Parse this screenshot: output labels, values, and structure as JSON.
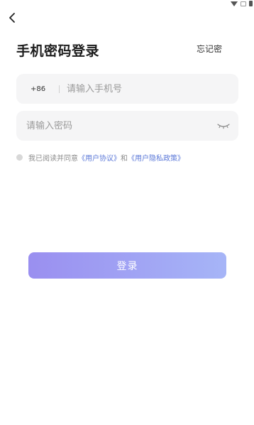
{
  "header": {
    "title": "手机密码登录",
    "forgot_label": "忘记密"
  },
  "phone": {
    "prefix": "+86",
    "placeholder": "请输入手机号"
  },
  "password": {
    "placeholder": "请输入密码"
  },
  "agreement": {
    "text": "我已阅读并同意",
    "link1": "《用户协议》",
    "conj": "和",
    "link2": "《用户隐私政策》"
  },
  "login_button": "登录",
  "icons": {
    "back": "chevron-left-icon",
    "eye": "eye-closed-icon"
  },
  "colors": {
    "accent_start": "#9a8ff0",
    "accent_end": "#a6b5f7",
    "link": "#5b78d8"
  }
}
